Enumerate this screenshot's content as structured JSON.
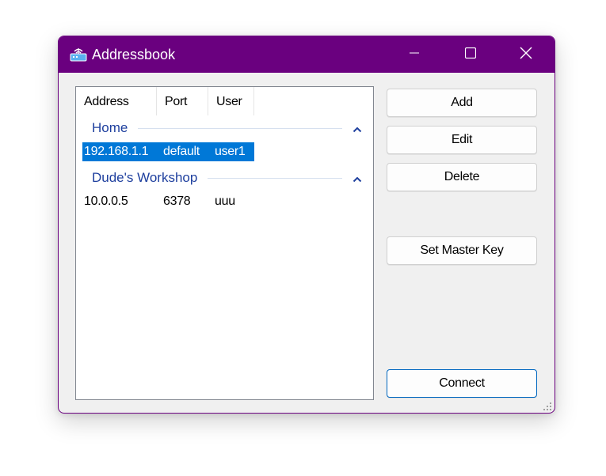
{
  "window": {
    "title": "Addressbook",
    "accent_color": "#6a007f",
    "app_icon": "router-icon"
  },
  "titlebar_buttons": {
    "minimize_icon": "minimize-icon",
    "maximize_icon": "maximize-icon",
    "close_icon": "close-icon"
  },
  "list": {
    "columns": [
      "Address",
      "Port",
      "User"
    ],
    "groups": [
      {
        "name": "Home",
        "collapse_icon": "chevron-up-icon",
        "rows": [
          {
            "address": "192.168.1.1",
            "port": "default",
            "user": "user1",
            "selected": true
          }
        ]
      },
      {
        "name": "Dude's Workshop",
        "collapse_icon": "chevron-up-icon",
        "rows": [
          {
            "address": "10.0.0.5",
            "port": "6378",
            "user": "uuu",
            "selected": false
          }
        ]
      }
    ],
    "selection_color": "#0078d7",
    "group_color": "#1e3f9e"
  },
  "buttons": {
    "add": "Add",
    "edit": "Edit",
    "delete": "Delete",
    "set_master_key": "Set Master Key",
    "connect": "Connect"
  }
}
